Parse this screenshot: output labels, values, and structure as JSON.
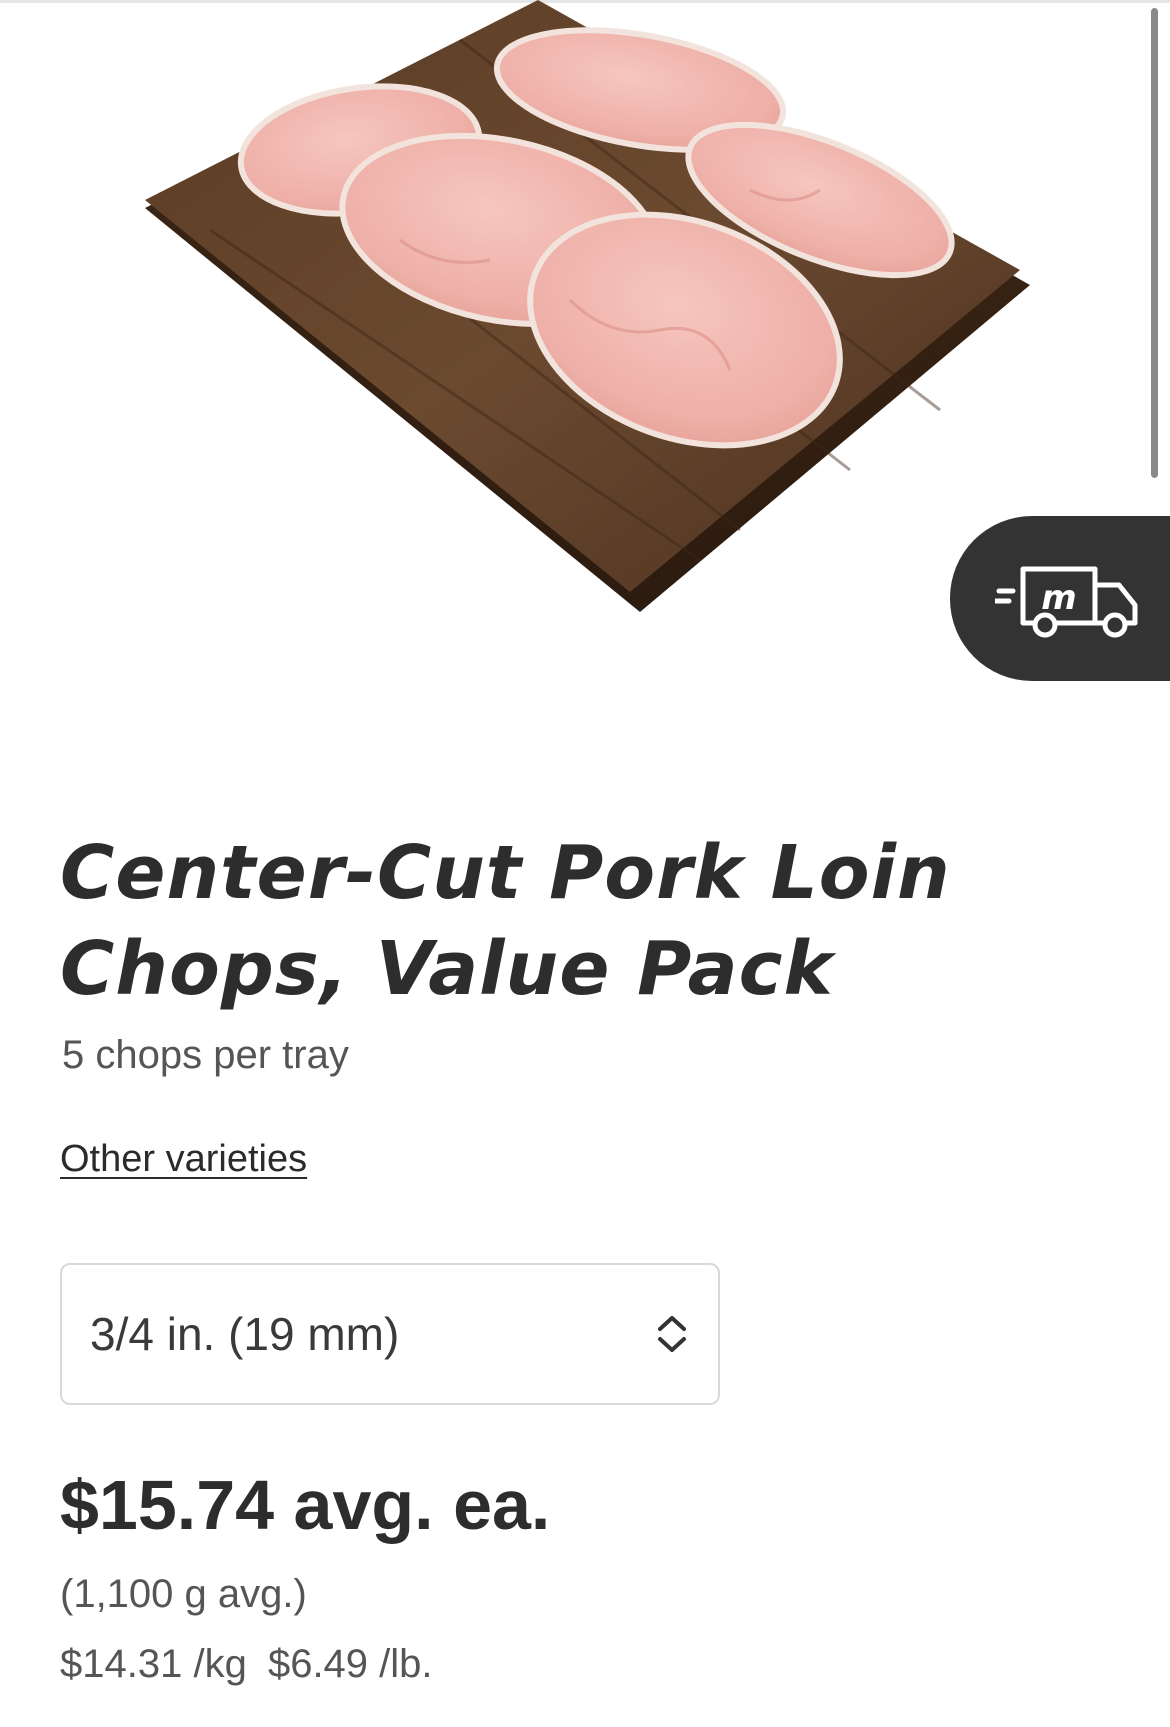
{
  "product": {
    "image_alt": "Center-Cut Pork Loin Chops on a wooden board",
    "title": "Center-Cut Pork Loin Chops, Value Pack",
    "subtitle": "5 chops per tray",
    "other_varieties_link": "Other varieties",
    "size_select": {
      "selected": "3/4 in. (19 mm)"
    },
    "price": "$15.74 avg. ea.",
    "average_weight": "(1,100 g avg.)",
    "price_per_kg": "$14.31 /kg",
    "price_per_lb": "$6.49 /lb."
  },
  "delivery_button": {
    "icon": "delivery-truck-icon",
    "logo_letter": "m"
  },
  "colors": {
    "fab_background": "#333333",
    "text_primary": "#2d2d2d",
    "text_secondary": "#555555"
  }
}
